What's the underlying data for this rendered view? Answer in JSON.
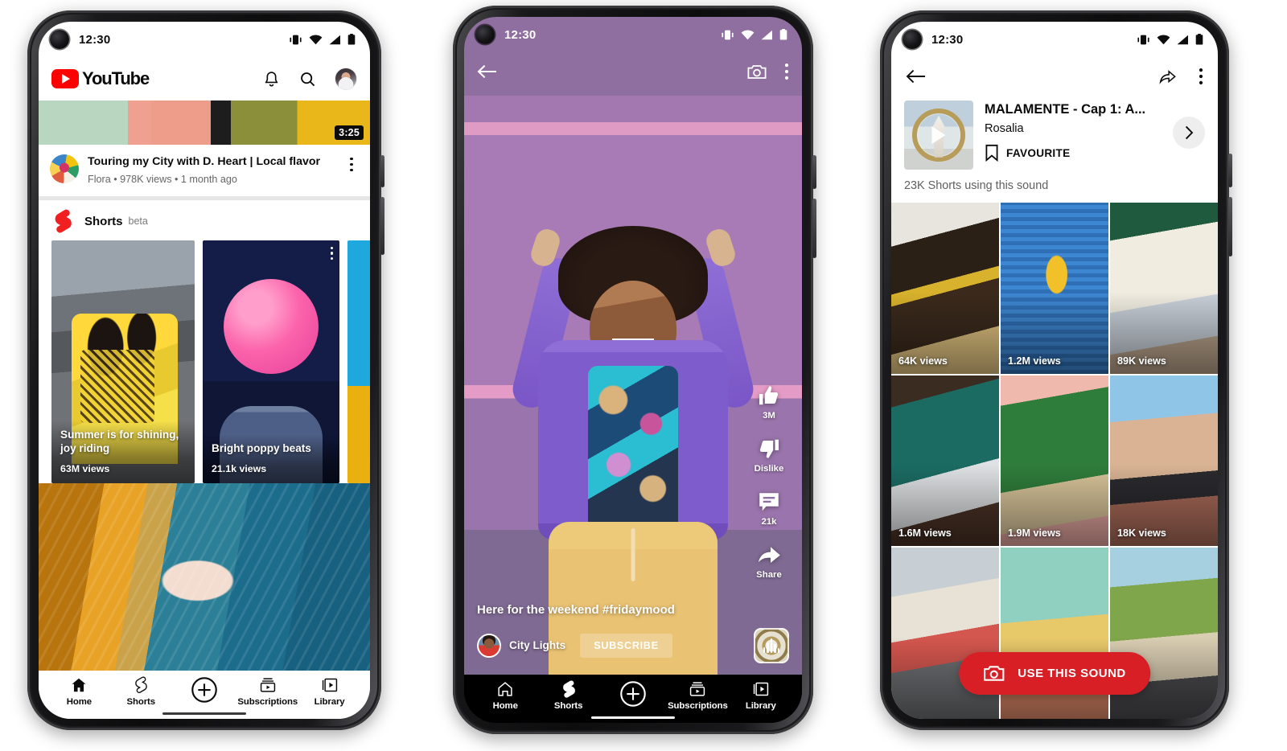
{
  "status_bar": {
    "time": "12:30",
    "icons": [
      "vibrate-icon",
      "wifi-icon",
      "signal-icon",
      "battery-icon"
    ]
  },
  "phone1": {
    "app_name": "YouTube",
    "header_icons": [
      "bell-icon",
      "search-icon",
      "account-avatar"
    ],
    "featured_video": {
      "duration": "3:25",
      "title": "Touring my City with D. Heart | Local flavor",
      "meta": "Flora • 978K views • 1 month ago"
    },
    "shorts_shelf": {
      "label": "Shorts",
      "badge": "beta",
      "cards": [
        {
          "title": "Summer is for shining, joy riding",
          "views": "63M views"
        },
        {
          "title": "Bright poppy beats",
          "views": "21.1k views"
        },
        {
          "title": "",
          "views": ""
        }
      ]
    },
    "bottom_nav": [
      {
        "label": "Home",
        "icon": "home-icon"
      },
      {
        "label": "Shorts",
        "icon": "shorts-icon"
      },
      {
        "label": "",
        "icon": "plus-circle-icon"
      },
      {
        "label": "Subscriptions",
        "icon": "subscriptions-icon"
      },
      {
        "label": "Library",
        "icon": "library-icon"
      }
    ]
  },
  "phone2": {
    "top_icons": [
      "back-arrow-icon",
      "camera-icon",
      "more-vertical-icon"
    ],
    "rail": [
      {
        "icon": "thumbs-up-icon",
        "label": "3M"
      },
      {
        "icon": "thumbs-down-icon",
        "label": "Dislike"
      },
      {
        "icon": "comment-icon",
        "label": "21k"
      },
      {
        "icon": "share-icon",
        "label": "Share"
      }
    ],
    "caption": "Here for the weekend #fridaymood",
    "channel": "City Lights",
    "subscribe_label": "SUBSCRIBE",
    "sound_disc_icon": "sound-equalizer-icon",
    "bottom_nav": [
      {
        "label": "Home",
        "icon": "home-icon"
      },
      {
        "label": "Shorts",
        "icon": "shorts-icon"
      },
      {
        "label": "",
        "icon": "plus-circle-icon"
      },
      {
        "label": "Subscriptions",
        "icon": "subscriptions-icon"
      },
      {
        "label": "Library",
        "icon": "library-icon"
      }
    ]
  },
  "phone3": {
    "top_icons": [
      "back-arrow-icon",
      "share-icon",
      "more-vertical-icon"
    ],
    "sound": {
      "title": "MALAMENTE - Cap 1: A...",
      "artist": "Rosalia",
      "favourite_label": "FAVOURITE",
      "favourite_icon": "bookmark-icon",
      "play_icon": "play-icon",
      "chevron_icon": "chevron-right-icon",
      "usage_count": "23K Shorts using this sound"
    },
    "grid": [
      {
        "views": "64K views"
      },
      {
        "views": "1.2M views"
      },
      {
        "views": "89K views"
      },
      {
        "views": "1.6M views"
      },
      {
        "views": "1.9M views"
      },
      {
        "views": "18K views"
      },
      {
        "views": ""
      },
      {
        "views": ""
      },
      {
        "views": ""
      }
    ],
    "use_sound": {
      "label": "USE THIS SOUND",
      "icon": "camera-icon",
      "color": "#d81f26"
    }
  },
  "colors": {
    "brand_red": "#ff0000",
    "cta_red": "#d81f26",
    "dark": "#0b0b0b"
  }
}
